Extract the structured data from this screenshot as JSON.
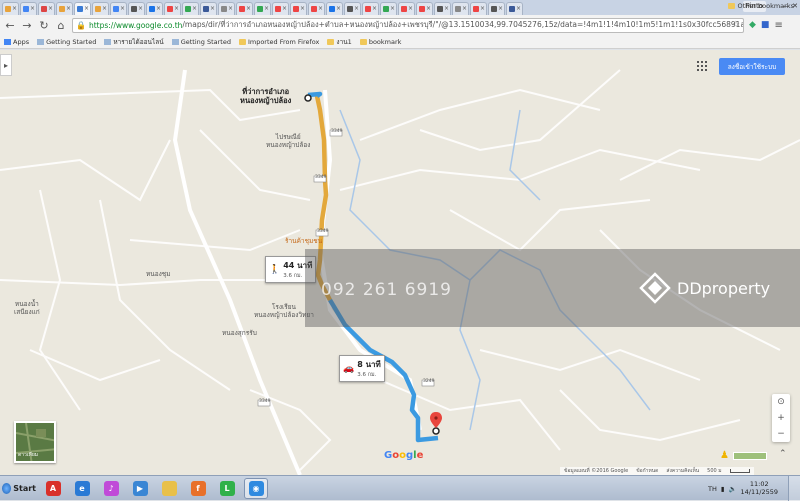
{
  "browser": {
    "tabs": [
      {
        "label": "C",
        "color": "#e8a33c"
      },
      {
        "label": "G",
        "color": "#4285f4"
      },
      {
        "label": "se",
        "color": "#d44"
      },
      {
        "label": "",
        "color": "#e8a33c"
      },
      {
        "label": "",
        "color": "#3a7bd5"
      },
      {
        "label": "",
        "color": "#e8a33c"
      },
      {
        "label": "",
        "color": "#4285f4"
      },
      {
        "label": "",
        "color": "#555"
      },
      {
        "label": "",
        "color": "#1a73e8"
      },
      {
        "label": "",
        "color": "#e44"
      },
      {
        "label": "",
        "color": "#34a853"
      },
      {
        "label": "",
        "color": "#3b5998"
      },
      {
        "label": "",
        "color": "#888"
      },
      {
        "label": "",
        "color": "#e44"
      },
      {
        "label": "",
        "color": "#34a853"
      },
      {
        "label": "",
        "color": "#e44"
      },
      {
        "label": "",
        "color": "#e44"
      },
      {
        "label": "",
        "color": "#e44"
      },
      {
        "label": "",
        "color": "#1a73e8"
      },
      {
        "label": "",
        "color": "#555"
      },
      {
        "label": "",
        "color": "#e44"
      },
      {
        "label": "",
        "color": "#34a853"
      },
      {
        "label": "",
        "color": "#e44"
      },
      {
        "label": "",
        "color": "#e44"
      },
      {
        "label": "",
        "color": "#555"
      },
      {
        "label": "",
        "color": "#888"
      },
      {
        "label": "",
        "color": "#e44"
      },
      {
        "label": "",
        "color": "#555"
      },
      {
        "label": "",
        "color": "#3b5998"
      }
    ],
    "user_label": "Pinto",
    "url_secure": "https://www.google.co.th",
    "url_rest": "/maps/dir/ที่ว่าการอำเภอหนองหญ้าปล้อง+ตำบล+หนองหญ้าปล้อง+เพชรบุรี/\"/@13.1510034,99.7045276,15z/data=!4m1!1!4m10!1m5!1m1!1s0x30fcc56891ac91cf:0x2",
    "bookmarks": [
      {
        "label": "Apps",
        "kind": "apps"
      },
      {
        "label": "Getting Started",
        "kind": "page"
      },
      {
        "label": "หารายได้ออนไลน์",
        "kind": "page"
      },
      {
        "label": "Getting Started",
        "kind": "page"
      },
      {
        "label": "Imported From Firefox",
        "kind": "folder"
      },
      {
        "label": "งาน1",
        "kind": "folder"
      },
      {
        "label": "bookmark",
        "kind": "folder"
      }
    ],
    "other_bookmarks": "Other bookmarks"
  },
  "map": {
    "signin_label": "ลงชื่อเข้าใช้ระบบ",
    "labels": {
      "origin": "ที่ว่าการอำเภอ\nหนองหญ้าปล้อง",
      "school": "ไปรษณีย์\nหนองหญ้าปล้อง",
      "shop": "ร้านค้าชุมชน",
      "village": "หนองชุม",
      "left1": "หนองน้ำ\nเสนียงแก่",
      "hospital": "โรงเรียน\nหนองหญ้าปล้องวิทยา",
      "bottom": "หนองสุกรรับ",
      "road1": "3349",
      "road2": "3349",
      "road3": "3349",
      "road4": "3249",
      "road5": "3349"
    },
    "route_alt": {
      "duration": "44 นาที",
      "distance": "3.6 กม."
    },
    "route_main": {
      "duration": "8 นาที",
      "distance": "3.6 กม."
    },
    "satellite_label": "ดาวเทียม",
    "google_logo": "Google",
    "footer": {
      "copyright": "ข้อมูลแผนที่ ©2016 Google",
      "terms": "ข้อกำหนด",
      "report": "ส่งความคิดเห็น",
      "scale": "500 ม"
    },
    "route_colors": {
      "main": "#3b9ae1",
      "alt": "#e3a83b"
    }
  },
  "watermark": {
    "phone": "092 261 6919",
    "brand": "DDproperty"
  },
  "taskbar": {
    "start_label": "Start",
    "apps": [
      {
        "name": "pdf-app",
        "color": "#d9302a",
        "glyph": "A"
      },
      {
        "name": "ie",
        "color": "#2a7ad5",
        "glyph": "e"
      },
      {
        "name": "itunes",
        "color": "#c04bd8",
        "glyph": "♪"
      },
      {
        "name": "media-player",
        "color": "#3a86d4",
        "glyph": "▶"
      },
      {
        "name": "folder",
        "color": "#e8c04a",
        "glyph": ""
      },
      {
        "name": "firefox",
        "color": "#e8702a",
        "glyph": "f"
      },
      {
        "name": "line",
        "color": "#2fb14a",
        "glyph": "L"
      },
      {
        "name": "chrome",
        "color": "#2f8ae0",
        "glyph": "◉",
        "active": true
      }
    ],
    "lang": "TH",
    "time": "11:02",
    "date": "14/11/2559"
  }
}
